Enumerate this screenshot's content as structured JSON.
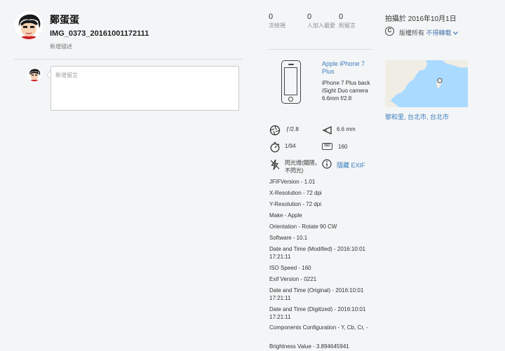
{
  "author": {
    "name": "鄭蛋蛋"
  },
  "photo": {
    "title": "IMG_0373_20161001172111",
    "add_description": "新增描述"
  },
  "comment": {
    "placeholder": "新增留言"
  },
  "stats": [
    {
      "value": "0",
      "label": "次檢視"
    },
    {
      "value": "0",
      "label": "人加入最愛"
    },
    {
      "value": "0",
      "label": "則留言"
    }
  ],
  "taken": {
    "text": "拍攝於 2016年10月1日"
  },
  "license": {
    "icon": "copyright-icon",
    "text": "版權所有",
    "link": "不得轉載"
  },
  "camera": {
    "model": "Apple iPhone 7 Plus",
    "lens": "iPhone 7 Plus back iSight Duo camera 6.6mm f/2.8"
  },
  "location": {
    "text": "黎和里, 台北市, 台北市"
  },
  "exif_summary": {
    "aperture": "ƒ/2.8",
    "focal_length": "6.6 mm",
    "shutter": "1/94",
    "iso": "160",
    "iso_label": "ISO",
    "flash": "閃光燈(關閉，不閃光)",
    "hide_exif": "隱藏 EXIF"
  },
  "exif_details": [
    "JFIFVersion - 1.01",
    "X-Resolution - 72 dpi",
    "Y-Resolution - 72 dpi",
    "Make - Apple",
    "Orientation - Rotate 90 CW",
    "Software - 10.1",
    "Date and Time (Modified) - 2016:10:01 17:21:11",
    "ISO Speed - 160",
    "Exif Version - 0221",
    "Date and Time (Original) - 2016:10:01 17:21:11",
    "Date and Time (Digitized) - 2016:10:01 17:21:11",
    "Components Configuration - Y, Cb, Cr, -",
    "Brightness Value - 3.894645941"
  ],
  "colors": {
    "link": "#3c7ebf",
    "background": "#f3f5f6",
    "map_water": "#aadaff",
    "map_land": "#f0ede5"
  }
}
